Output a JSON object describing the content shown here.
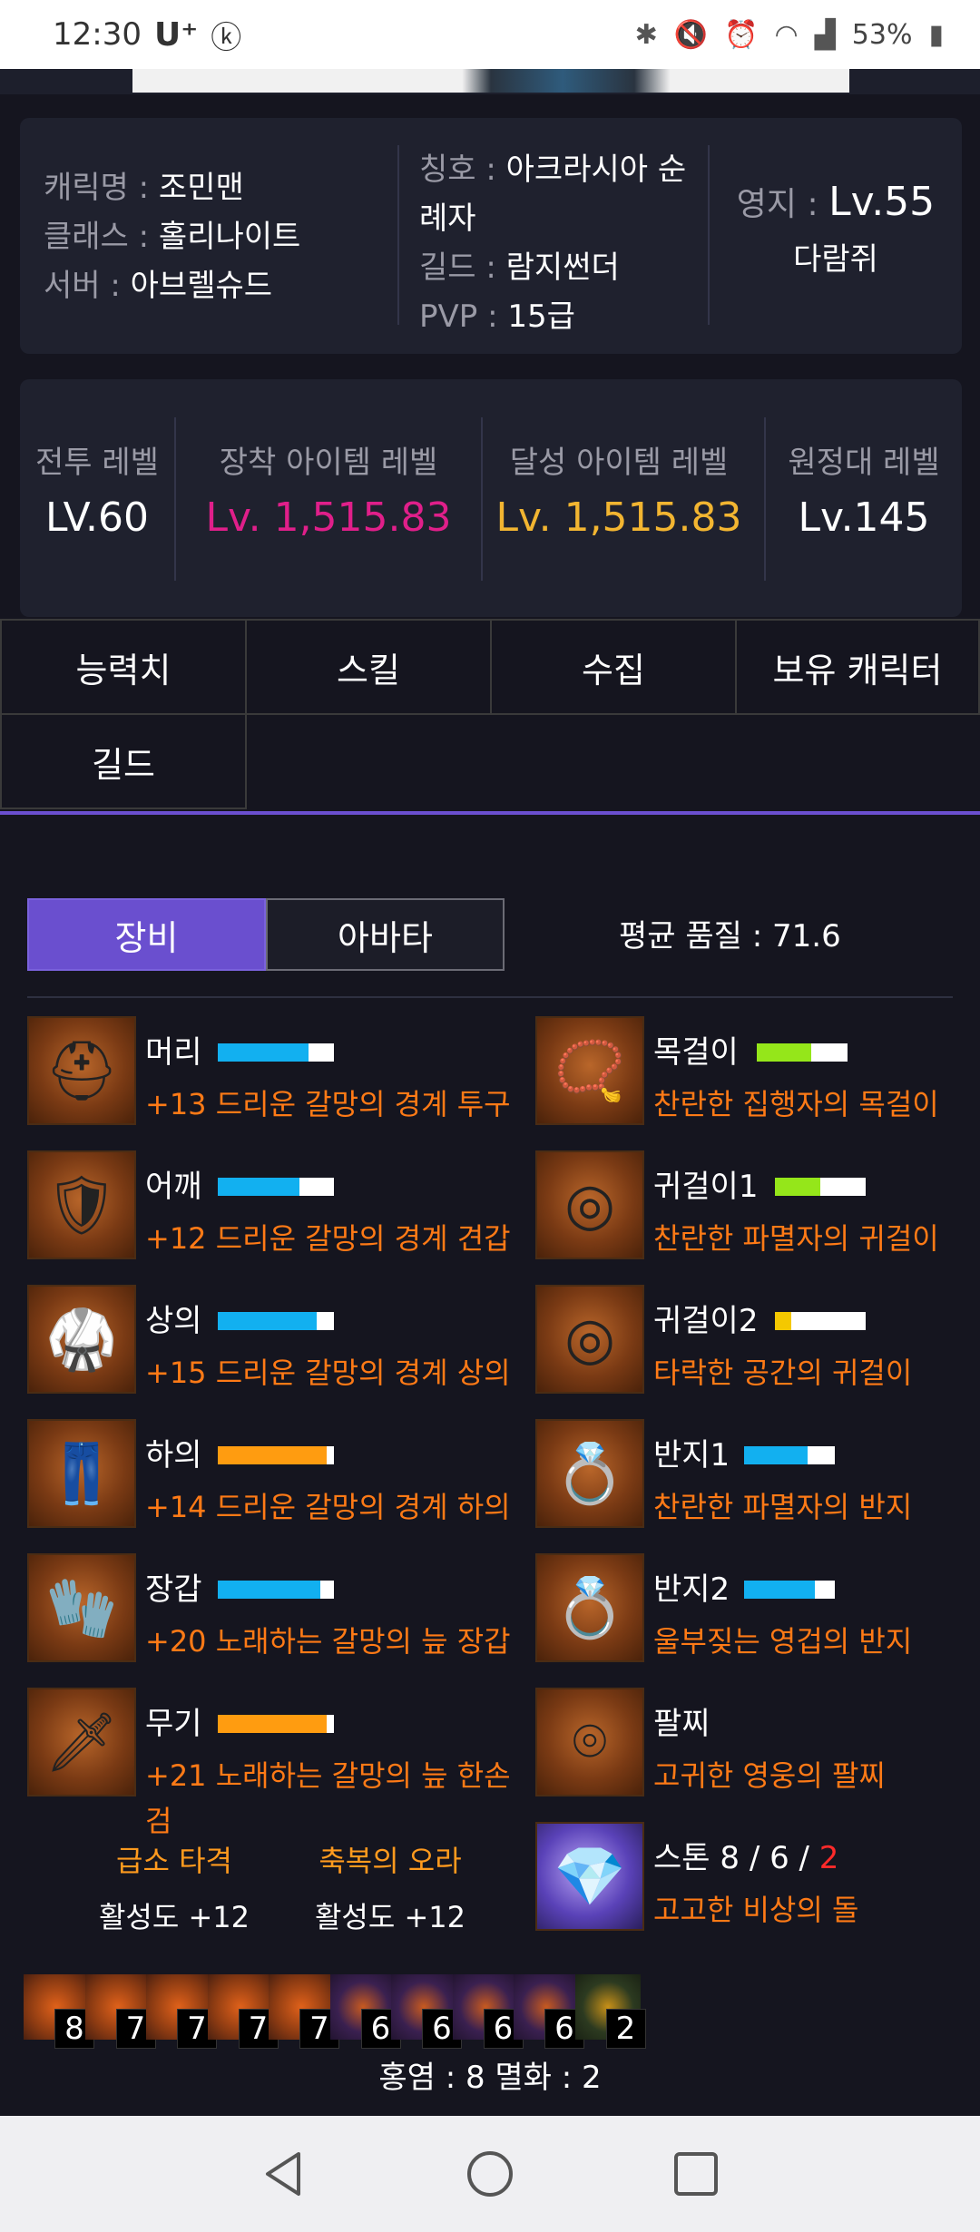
{
  "status_bar": {
    "time": "12:30",
    "carrier": "U⁺",
    "battery": "53%"
  },
  "profile": {
    "char_name_label": "캐릭명 :",
    "char_name": "조민맨",
    "class_label": "클래스 :",
    "class": "홀리나이트",
    "server_label": "서버 :",
    "server": "아브렐슈드",
    "title_label": "칭호 :",
    "title_line1": "아크라시아 순",
    "title_line2": "례자",
    "guild_label": "길드 :",
    "guild": "람지썬더",
    "pvp_label": "PVP :",
    "pvp": "15급",
    "territory_label": "영지 :",
    "territory_level": "Lv.55",
    "territory_name": "다람쥐"
  },
  "levels": [
    {
      "label": "전투 레벨",
      "value": "LV.60",
      "color": "#ffffff"
    },
    {
      "label": "장착 아이템 레벨",
      "value": "Lv. 1,515.83",
      "color": "#e01f8a"
    },
    {
      "label": "달성 아이템 레벨",
      "value": "Lv. 1,515.83",
      "color": "#f2b531"
    },
    {
      "label": "원정대 레벨",
      "value": "Lv.145",
      "color": "#ffffff"
    }
  ],
  "tabs": [
    "능력치",
    "스킬",
    "수집",
    "보유 캐릭터",
    "길드"
  ],
  "equip_tabs": {
    "equipment": "장비",
    "avatar": "아바타"
  },
  "avg_quality": "평균 품질 : 71.6",
  "colors": {
    "accent": "#6a4fcf",
    "item_orange": "#ff7a16",
    "quality_blue": "#12b0f0",
    "quality_orange": "#ff9c10",
    "quality_green": "#95e61a",
    "quality_yellow": "#f4c800"
  },
  "gear": [
    {
      "slot": "머리",
      "name": "+13 드리운 갈망의 경계 투구",
      "quality": 78,
      "quality_color": "#12b0f0",
      "icon": "hood-icon"
    },
    {
      "slot": "어깨",
      "name": "+12 드리운 갈망의 경계 견갑",
      "quality": 70,
      "quality_color": "#12b0f0",
      "icon": "shoulder-icon"
    },
    {
      "slot": "상의",
      "name": "+15 드리운 갈망의 경계 상의",
      "quality": 85,
      "quality_color": "#12b0f0",
      "icon": "chest-icon"
    },
    {
      "slot": "하의",
      "name": "+14 드리운 갈망의 경계 하의",
      "quality": 94,
      "quality_color": "#ff9c10",
      "icon": "pants-icon"
    },
    {
      "slot": "장갑",
      "name": "+20 노래하는 갈망의 늪 장갑",
      "quality": 88,
      "quality_color": "#12b0f0",
      "icon": "glove-icon"
    },
    {
      "slot": "무기",
      "name": "+21 노래하는 갈망의 늪 한손",
      "name2": "검",
      "quality": 94,
      "quality_color": "#ff9c10",
      "icon": "sword-icon"
    }
  ],
  "accessories": [
    {
      "slot": "목걸이",
      "name": "찬란한 집행자의 목걸이",
      "quality": 60,
      "quality_color": "#95e61a",
      "icon": "necklace-icon"
    },
    {
      "slot": "귀걸이1",
      "name": "찬란한 파멸자의 귀걸이",
      "quality": 50,
      "quality_color": "#95e61a",
      "icon": "earring-icon"
    },
    {
      "slot": "귀걸이2",
      "name": "타락한 공간의 귀걸이",
      "quality": 18,
      "quality_color": "#f4c800",
      "icon": "earring-icon"
    },
    {
      "slot": "반지1",
      "name": "찬란한 파멸자의 반지",
      "quality": 70,
      "quality_color": "#12b0f0",
      "icon": "ring-icon"
    },
    {
      "slot": "반지2",
      "name": "울부짖는 영겁의 반지",
      "quality": 78,
      "quality_color": "#12b0f0",
      "icon": "ring-icon"
    },
    {
      "slot": "팔찌",
      "name": "고귀한 영웅의 팔찌",
      "icon": "bracelet-icon"
    }
  ],
  "stone": {
    "slot": "스톤",
    "values_prefix": "8 / 6 / ",
    "values_red": "2",
    "name": "고고한 비상의 돌"
  },
  "engravings": [
    {
      "name": "급소 타격",
      "activity": "활성도 +12"
    },
    {
      "name": "축복의 오라",
      "activity": "활성도 +12"
    }
  ],
  "gems": [
    {
      "level": "8",
      "type": "orange"
    },
    {
      "level": "7",
      "type": "orange"
    },
    {
      "level": "7",
      "type": "orange"
    },
    {
      "level": "7",
      "type": "orange"
    },
    {
      "level": "7",
      "type": "orange"
    },
    {
      "level": "6",
      "type": "purple"
    },
    {
      "level": "6",
      "type": "purple"
    },
    {
      "level": "6",
      "type": "purple"
    },
    {
      "level": "6",
      "type": "purple"
    },
    {
      "level": "2",
      "type": "green"
    }
  ],
  "gem_summary": "홍염 : 8   멸화 : 2"
}
